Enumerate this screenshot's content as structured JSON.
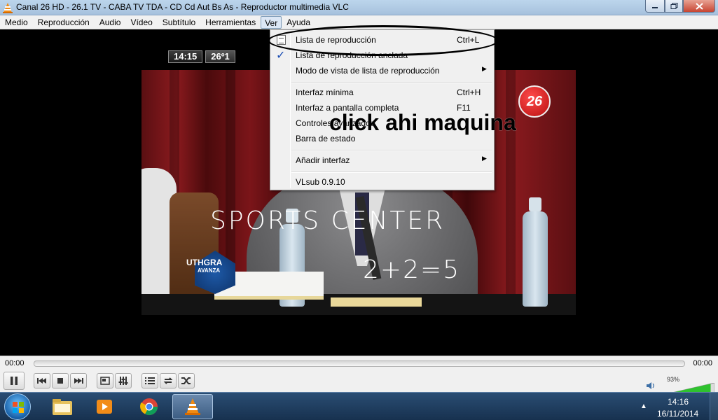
{
  "window": {
    "title": "Canal 26 HD - 26.1 TV - CABA TV TDA - CD Cd Aut Bs As - Reproductor multimedia VLC",
    "minimize_icon": "minimize-icon",
    "maximize_icon": "maximize-icon",
    "close_icon": "close-icon"
  },
  "menubar": {
    "items": [
      "Medio",
      "Reproducción",
      "Audio",
      "Vídeo",
      "Subtítulo",
      "Herramientas",
      "Ver",
      "Ayuda"
    ],
    "active": "Ver"
  },
  "ver_menu": {
    "items": [
      {
        "label": "Lista de reproducción",
        "shortcut": "Ctrl+L",
        "icon": "playlist-icon"
      },
      {
        "label": "Lista de reproducción anclada",
        "checked": true
      },
      {
        "label": "Modo de vista de lista de reproducción",
        "submenu": true
      },
      {
        "label": "Interfaz mínima",
        "shortcut": "Ctrl+H"
      },
      {
        "label": "Interfaz a pantalla completa",
        "shortcut": "F11"
      },
      {
        "label": "Controles avanzados"
      },
      {
        "label": "Barra de estado"
      },
      {
        "label": "Añadir interfaz",
        "submenu": true
      },
      {
        "label": "VLsub 0.9.10"
      }
    ]
  },
  "video": {
    "osd_time": "14:15",
    "osd_temp": "26º1",
    "channel_logo": "26",
    "logo_text": "UTHGRA",
    "logo_subtext": "AVANZA",
    "scrawl_1": "SPORTS CENTER",
    "scrawl_2": "2+2=5",
    "annotation": "click ahi maquina"
  },
  "controls": {
    "time_elapsed": "00:00",
    "time_total": "00:00",
    "volume_percent": "93%",
    "volume_level": 0.93,
    "buttons": [
      "pause-icon",
      "previous-icon",
      "stop-icon",
      "next-icon",
      "fullscreen-icon",
      "extended-settings-icon",
      "playlist-icon",
      "loop-icon",
      "shuffle-icon"
    ]
  },
  "taskbar": {
    "clock_time": "14:16",
    "clock_date": "16/11/2014",
    "apps": [
      "explorer-icon",
      "media-player-icon",
      "chrome-icon",
      "vlc-icon"
    ],
    "active_app": "vlc-icon"
  }
}
